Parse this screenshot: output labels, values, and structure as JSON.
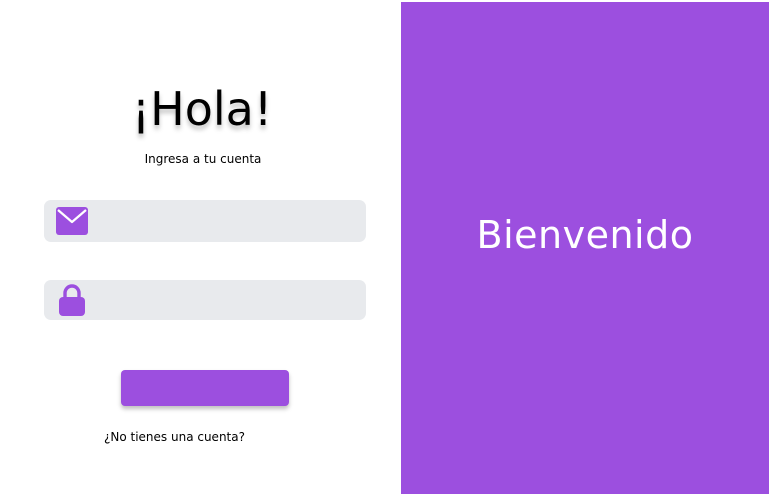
{
  "login": {
    "title": "¡Hola!",
    "subtitle": "Ingresa a tu cuenta",
    "email_field": {
      "value": "",
      "placeholder": "",
      "icon": "mail-icon"
    },
    "password_field": {
      "value": "",
      "placeholder": "",
      "icon": "lock-icon"
    },
    "submit_label": "",
    "signup_link": "¿No tienes una cuenta?"
  },
  "welcome_panel": {
    "text": "Bienvenido"
  },
  "colors": {
    "accent": "#9c4fdf",
    "field_bg": "#e8eaed",
    "background": "#ffffff"
  }
}
